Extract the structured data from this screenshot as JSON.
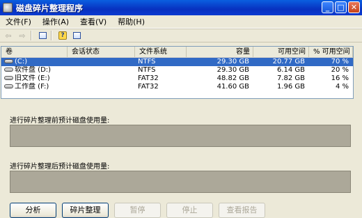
{
  "window": {
    "title": "磁盘碎片整理程序"
  },
  "title_buttons": {
    "minimize": "_",
    "maximize": "□",
    "close": "✕"
  },
  "menu": [
    {
      "label": "文件(F)"
    },
    {
      "label": "操作(A)"
    },
    {
      "label": "查看(V)"
    },
    {
      "label": "帮助(H)"
    }
  ],
  "toolbar": {
    "icons": [
      "back-arrow-icon",
      "forward-arrow-icon",
      "properties-icon",
      "help-icon",
      "details-icon"
    ],
    "back_glyph": "⇦",
    "forward_glyph": "⇨"
  },
  "list": {
    "columns": [
      "卷",
      "会话状态",
      "文件系统",
      "容量",
      "可用空间",
      "% 可用空间"
    ],
    "rows": [
      {
        "volume": "(C:)",
        "session": "",
        "fs": "NTFS",
        "capacity": "29.30 GB",
        "free": "20.77 GB",
        "pct_free": "70 %",
        "selected": true
      },
      {
        "volume": "软件盘 (D:)",
        "session": "",
        "fs": "NTFS",
        "capacity": "29.30 GB",
        "free": "6.14 GB",
        "pct_free": "20 %",
        "selected": false
      },
      {
        "volume": "旧文件 (E:)",
        "session": "",
        "fs": "FAT32",
        "capacity": "48.82 GB",
        "free": "7.82 GB",
        "pct_free": "16 %",
        "selected": false
      },
      {
        "volume": "工作盘 (F:)",
        "session": "",
        "fs": "FAT32",
        "capacity": "41.60 GB",
        "free": "1.96 GB",
        "pct_free": "4 %",
        "selected": false
      }
    ]
  },
  "panels": {
    "before_label": "进行碎片整理前预计磁盘使用量:",
    "after_label": "进行碎片整理后预计磁盘使用量:"
  },
  "buttons": {
    "analyze": "分析",
    "defragment": "碎片整理",
    "pause": "暂停",
    "stop": "停止",
    "view_report": "查看报告"
  },
  "colors": {
    "selection": "#316ac5",
    "panel_fill": "#aca899",
    "titlebar": "#0a3ad0"
  }
}
